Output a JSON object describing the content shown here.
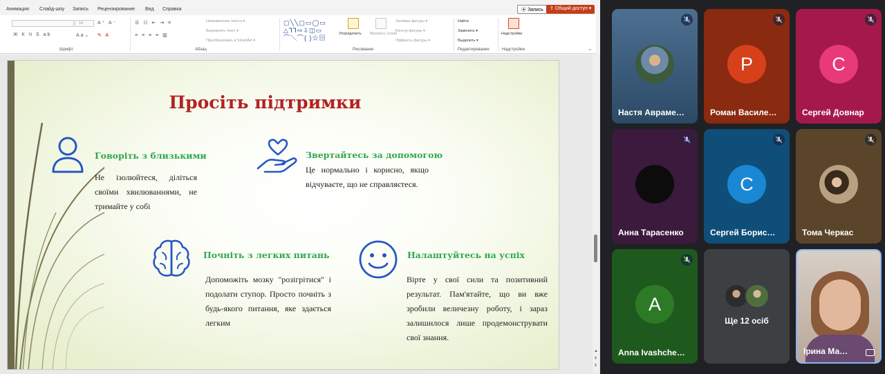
{
  "menu": {
    "items": [
      "Анимация",
      "Слайд-шоу",
      "Запись",
      "Рецензирование",
      "Вид",
      "Справка"
    ],
    "record_label": "⦿ Запись",
    "share_label": "⇪ Общий доступ ▾"
  },
  "ribbon": {
    "font_size": "18",
    "text_direction": "Направление текста ▾",
    "align_text": "Выровнять текст ▾",
    "smartart": "Преобразовать в SmartArt ▾",
    "arrange": "Упорядочить",
    "express_styles": "Экспресс-стили",
    "shape_fill": "Заливка фигуры ▾",
    "shape_outline": "Контур фигуры ▾",
    "shape_effects": "Эффекты фигуры ▾",
    "find": "Найти",
    "replace": "Заменить ▾",
    "select": "Выделить ▾",
    "addins": "Надстройки",
    "groups": {
      "font": "Шрифт",
      "paragraph": "Абзац",
      "drawing": "Рисование",
      "editing": "Редактирование",
      "addins": "Надстройки"
    }
  },
  "slide": {
    "title": "Просіть підтримки",
    "items": [
      {
        "heading": "Говоріть з близькими",
        "body": "Не ізолюйтеся, діліться своїми хвилюваннями, не тримайте у собі",
        "icon": "person-icon"
      },
      {
        "heading": "Звертайтесь за допомогою",
        "body": "Це нормально і корисно, якщо відчуваєте, що не справляєтеся.",
        "icon": "hand-heart-icon"
      },
      {
        "heading": "Почніть з легких питань",
        "body": "Допоможіть мозку \"розігрітися\" і подолати ступор. Просто почніть з будь-якого питання, яке здається легким",
        "icon": "brain-icon"
      },
      {
        "heading": "Налаштуйтесь на успіх",
        "body": "Вірте у свої сили та позитивний результат. Пам'ятайте, що ви вже зробили величезну роботу, і зараз залишилося лише продемонструвати свої знання.",
        "icon": "smile-icon"
      }
    ]
  },
  "participants": [
    {
      "name": "Настя Авраме…",
      "type": "photo",
      "bg": "#3b5a7a",
      "muted": true
    },
    {
      "name": "Роман Василе…",
      "type": "letter",
      "letter": "P",
      "bg": "#8a2a10",
      "avatar_color": "#d6401a",
      "muted": true
    },
    {
      "name": "Сергей Довнар",
      "type": "letter",
      "letter": "C",
      "bg": "#a5194a",
      "avatar_color": "#e83a77",
      "muted": true
    },
    {
      "name": "Анна Тарасенко",
      "type": "dark",
      "bg": "#3b1a3d",
      "muted": true
    },
    {
      "name": "Сергей Борис…",
      "type": "letter",
      "letter": "C",
      "bg": "#0e4e78",
      "avatar_color": "#1a87d4",
      "muted": true
    },
    {
      "name": "Тома Черкас",
      "type": "photo",
      "bg": "#5a452a",
      "muted": true
    },
    {
      "name": "Anna Ivashche…",
      "type": "letter",
      "letter": "A",
      "bg": "#1e5a1e",
      "avatar_color": "#2d7a26",
      "muted": true
    },
    {
      "name": "Ще 12 осіб",
      "type": "more",
      "bg": "#3c4043"
    },
    {
      "name": "Ірина Ма…",
      "type": "video",
      "bg": "#c9b8a8",
      "muted": false
    }
  ]
}
